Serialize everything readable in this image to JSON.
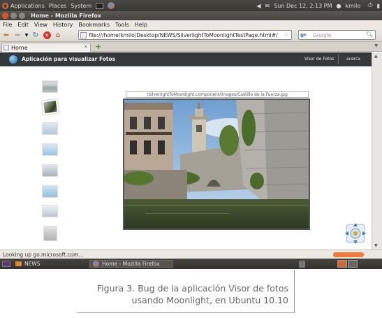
{
  "top_panel": {
    "applications": "Applications",
    "places": "Places",
    "system": "System",
    "clock": "Sun Dec 12,  2:13 PM",
    "user": "kmilo"
  },
  "window": {
    "title": "Home - Mozilla Firefox"
  },
  "menu": [
    "File",
    "Edit",
    "View",
    "History",
    "Bookmarks",
    "Tools",
    "Help"
  ],
  "navigation": {
    "url": "file:///home/kmilo/Desktop/NEWS/SilverlightToMoonlightTestPage.html#/",
    "search_placeholder": "Google"
  },
  "tab": {
    "label": "Home"
  },
  "app": {
    "title": "Aplicación para visualizar Fotos",
    "nav": [
      "Visor de Fotos",
      "acerca"
    ]
  },
  "viewer": {
    "path": "/SilverlightToMoonlight.component/images/Castillo de la Fuerza.jpg",
    "thumbnail_count": 8
  },
  "status": {
    "text": "Looking up go.microsoft.com..."
  },
  "taskbar": {
    "items": [
      "NEWS",
      "Home - Mozilla Firefox"
    ]
  },
  "caption": {
    "line1": "Figura 3. Bug de la aplicación Visor de fotos",
    "line2": "usando Moonlight, en Ubuntu 10.10"
  },
  "colors": {
    "app_bar": "#36393b",
    "panel": "#3c3b37",
    "firefox_close": "#e0522a"
  }
}
